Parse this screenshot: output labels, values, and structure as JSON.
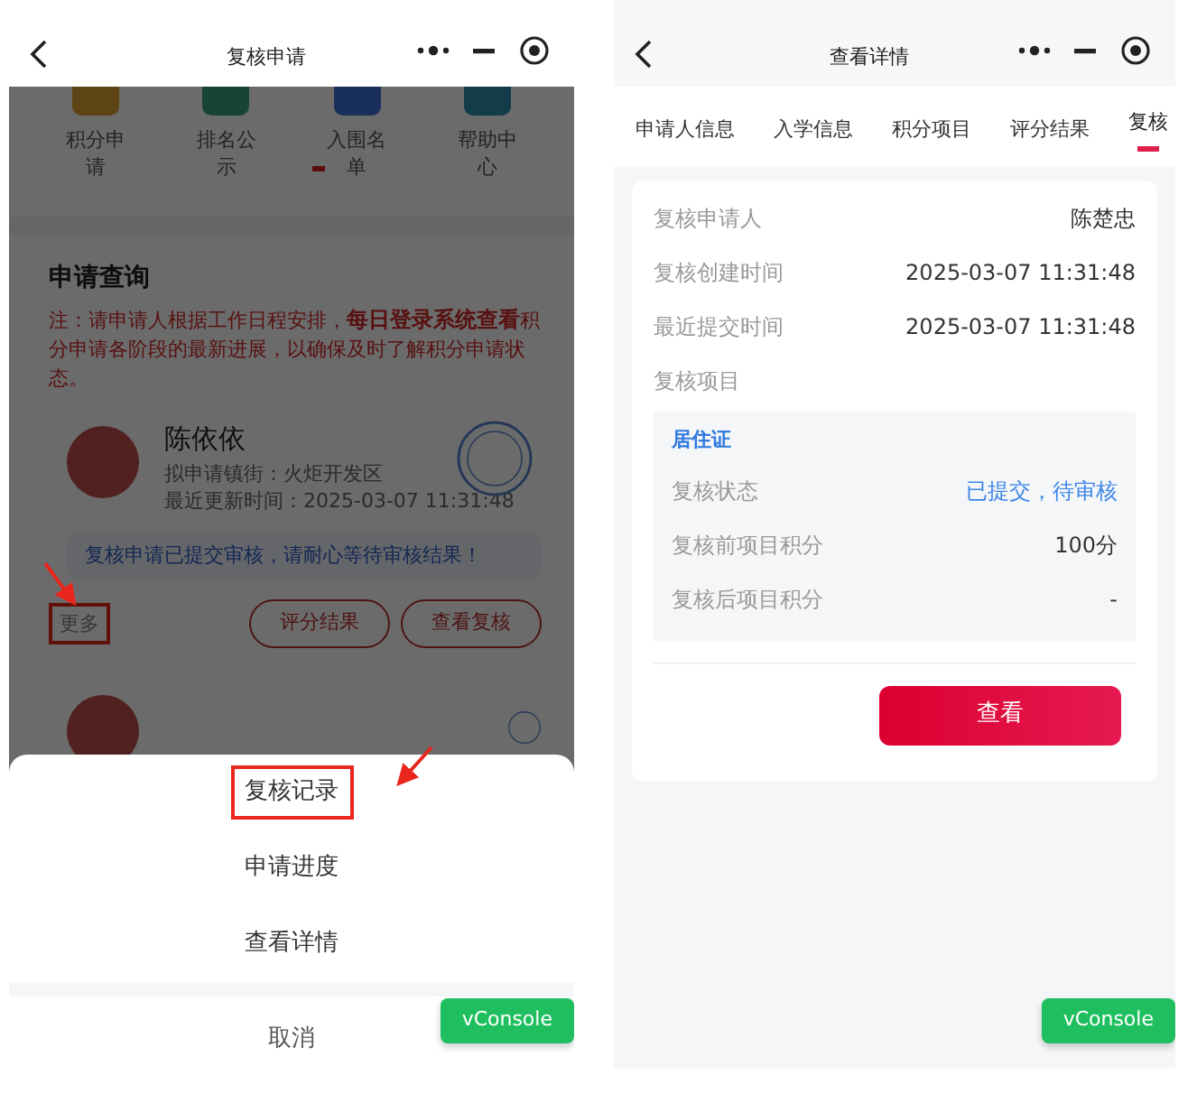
{
  "left_screen": {
    "title": "复核申请",
    "menu_grid": [
      {
        "label": "积分申请"
      },
      {
        "label": "排名公示"
      },
      {
        "label": "入围名单"
      },
      {
        "label": "帮助中心"
      }
    ],
    "section_title": "申请查询",
    "notice": "注：请申请人根据工作日程安排，**每日登录系统查看**积分申请各阶段的最新进展，以确保及时了解积分申请状态。",
    "applicants": [
      {
        "name": "陈依依",
        "district": "拟申请镇街：火炬开发区",
        "updated": "最近更新时间：2025-03-07 11:31:48",
        "message": "复核申请已提交审核，请耐心等待审核结果！",
        "more": {
          "label": "更多",
          "annotated": true
        },
        "buttons": [
          "评分结果",
          "查看复核"
        ]
      }
    ],
    "action_sheet": {
      "options": [
        {
          "label": "复核记录",
          "annotated": true
        },
        {
          "label": "申请进度",
          "annotated": false
        },
        {
          "label": "查看详情",
          "annotated": false
        }
      ],
      "cancel": "取消"
    },
    "vconsole": "vConsole"
  },
  "right_screen": {
    "title": "查看详情",
    "tabs": [
      {
        "label": "申请人信息",
        "selected": false
      },
      {
        "label": "入学信息",
        "selected": false
      },
      {
        "label": "积分项目",
        "selected": false
      },
      {
        "label": "评分结果",
        "selected": false
      },
      {
        "label": "复核",
        "selected": true
      }
    ],
    "details": [
      {
        "label": "复核申请人",
        "value": "陈楚忠"
      },
      {
        "label": "复核创建时间",
        "value": "2025-03-07 11:31:48"
      },
      {
        "label": "最近提交时间",
        "value": "2025-03-07 11:31:48"
      },
      {
        "label": "复核项目"
      }
    ],
    "item": {
      "title": "居住证",
      "rows": [
        {
          "label": "复核状态",
          "value": "已提交，待审核",
          "kind": "status"
        },
        {
          "label": "复核前项目积分",
          "value": "100分",
          "kind": "plain"
        },
        {
          "label": "复核后项目积分",
          "value": "-",
          "kind": "plain"
        }
      ]
    },
    "button": "查看",
    "vconsole": "vConsole"
  }
}
